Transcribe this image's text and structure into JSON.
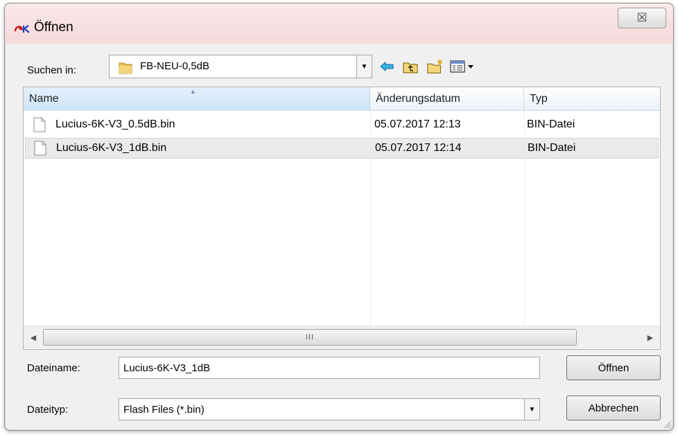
{
  "window": {
    "title": "Öffnen",
    "close_glyph": "☒"
  },
  "lookin": {
    "label": "Suchen in:",
    "value": "FB-NEU-0,5dB"
  },
  "toolbar": {
    "icons": [
      "back-icon",
      "up-folder-icon",
      "new-folder-icon",
      "view-menu-icon"
    ]
  },
  "list": {
    "columns": {
      "name": "Name",
      "date": "Änderungsdatum",
      "type": "Typ"
    },
    "rows": [
      {
        "name": "Lucius-6K-V3_0.5dB.bin",
        "date": "05.07.2017 12:13",
        "type": "BIN-Datei"
      },
      {
        "name": "Lucius-6K-V3_1dB.bin",
        "date": "05.07.2017 12:14",
        "type": "BIN-Datei"
      }
    ],
    "scroll_grip": "III"
  },
  "filename": {
    "label": "Dateiname:",
    "value": "Lucius-6K-V3_1dB"
  },
  "filetype": {
    "label": "Dateityp:",
    "value": "Flash Files (*.bin)"
  },
  "buttons": {
    "open": "Öffnen",
    "cancel": "Abbrechen"
  },
  "colors": {
    "title_bar": "#f4d9db",
    "selection": "#eaeaea",
    "header_sorted": "#cfe3f7"
  }
}
